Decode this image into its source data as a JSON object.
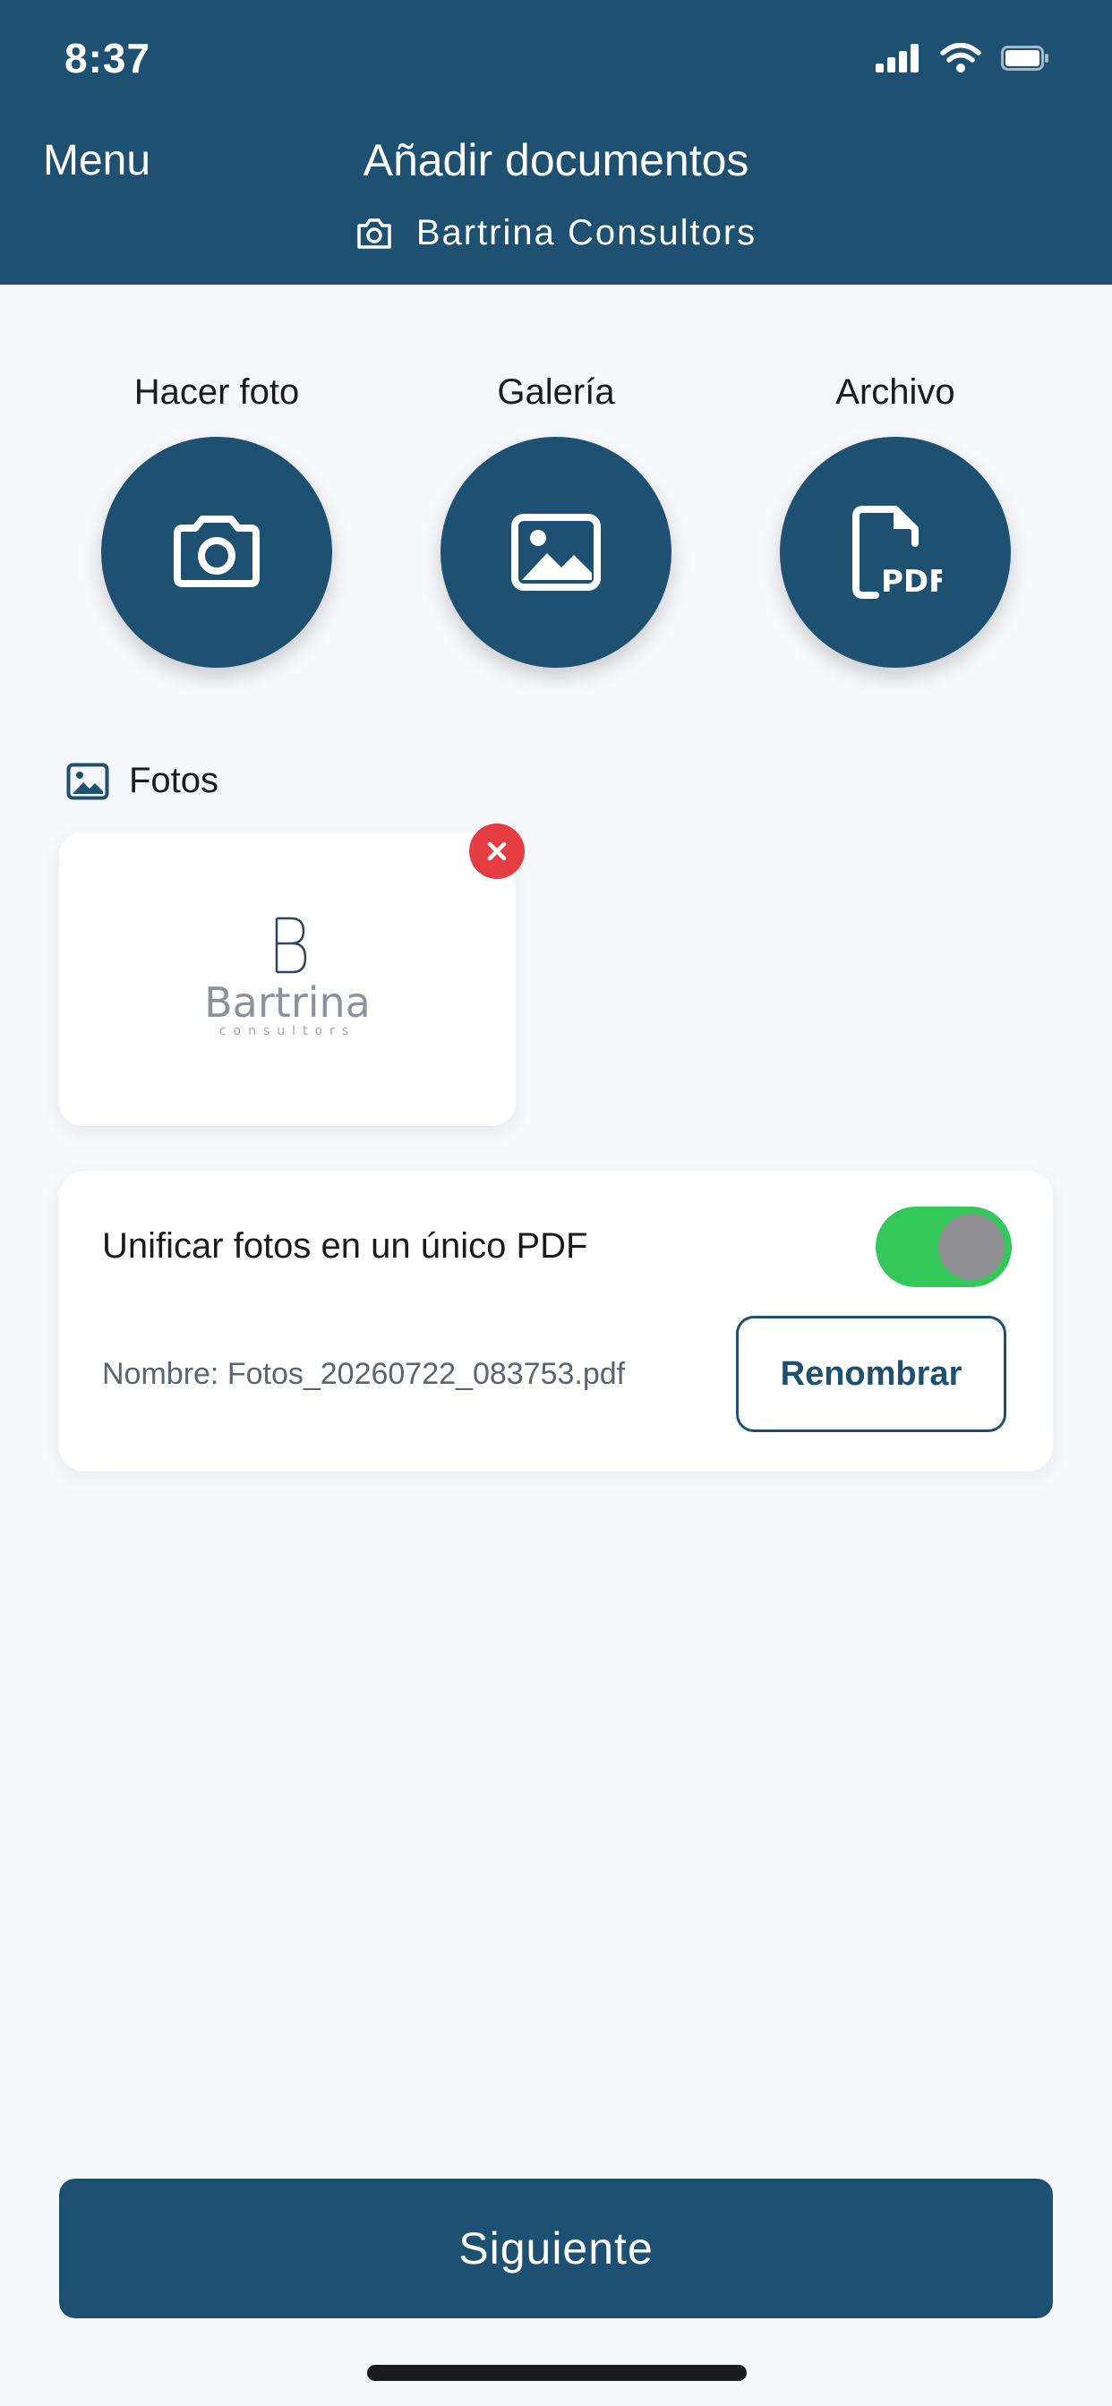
{
  "status_bar": {
    "time": "8:37"
  },
  "header": {
    "menu_label": "Menu",
    "title": "Añadir documentos",
    "subtitle": "Bartrina Consultors"
  },
  "actions": [
    {
      "label": "Hacer foto",
      "icon": "camera-icon"
    },
    {
      "label": "Galería",
      "icon": "image-icon"
    },
    {
      "label": "Archivo",
      "icon": "pdf-file-icon"
    }
  ],
  "fotos": {
    "section_label": "Fotos",
    "photos": [
      {
        "logo_text": "Bartrina",
        "logo_subtext": "consultors"
      }
    ]
  },
  "merge": {
    "label": "Unificar fotos en un único PDF",
    "toggle_on": true,
    "name_text": "Nombre: Fotos_20260722_083753.pdf",
    "rename_label": "Renombrar"
  },
  "footer": {
    "next_label": "Siguiente"
  },
  "colors": {
    "primary": "#1e5072",
    "toggle_on": "#34c759",
    "danger": "#e53e42",
    "background": "#f7f8fb"
  }
}
